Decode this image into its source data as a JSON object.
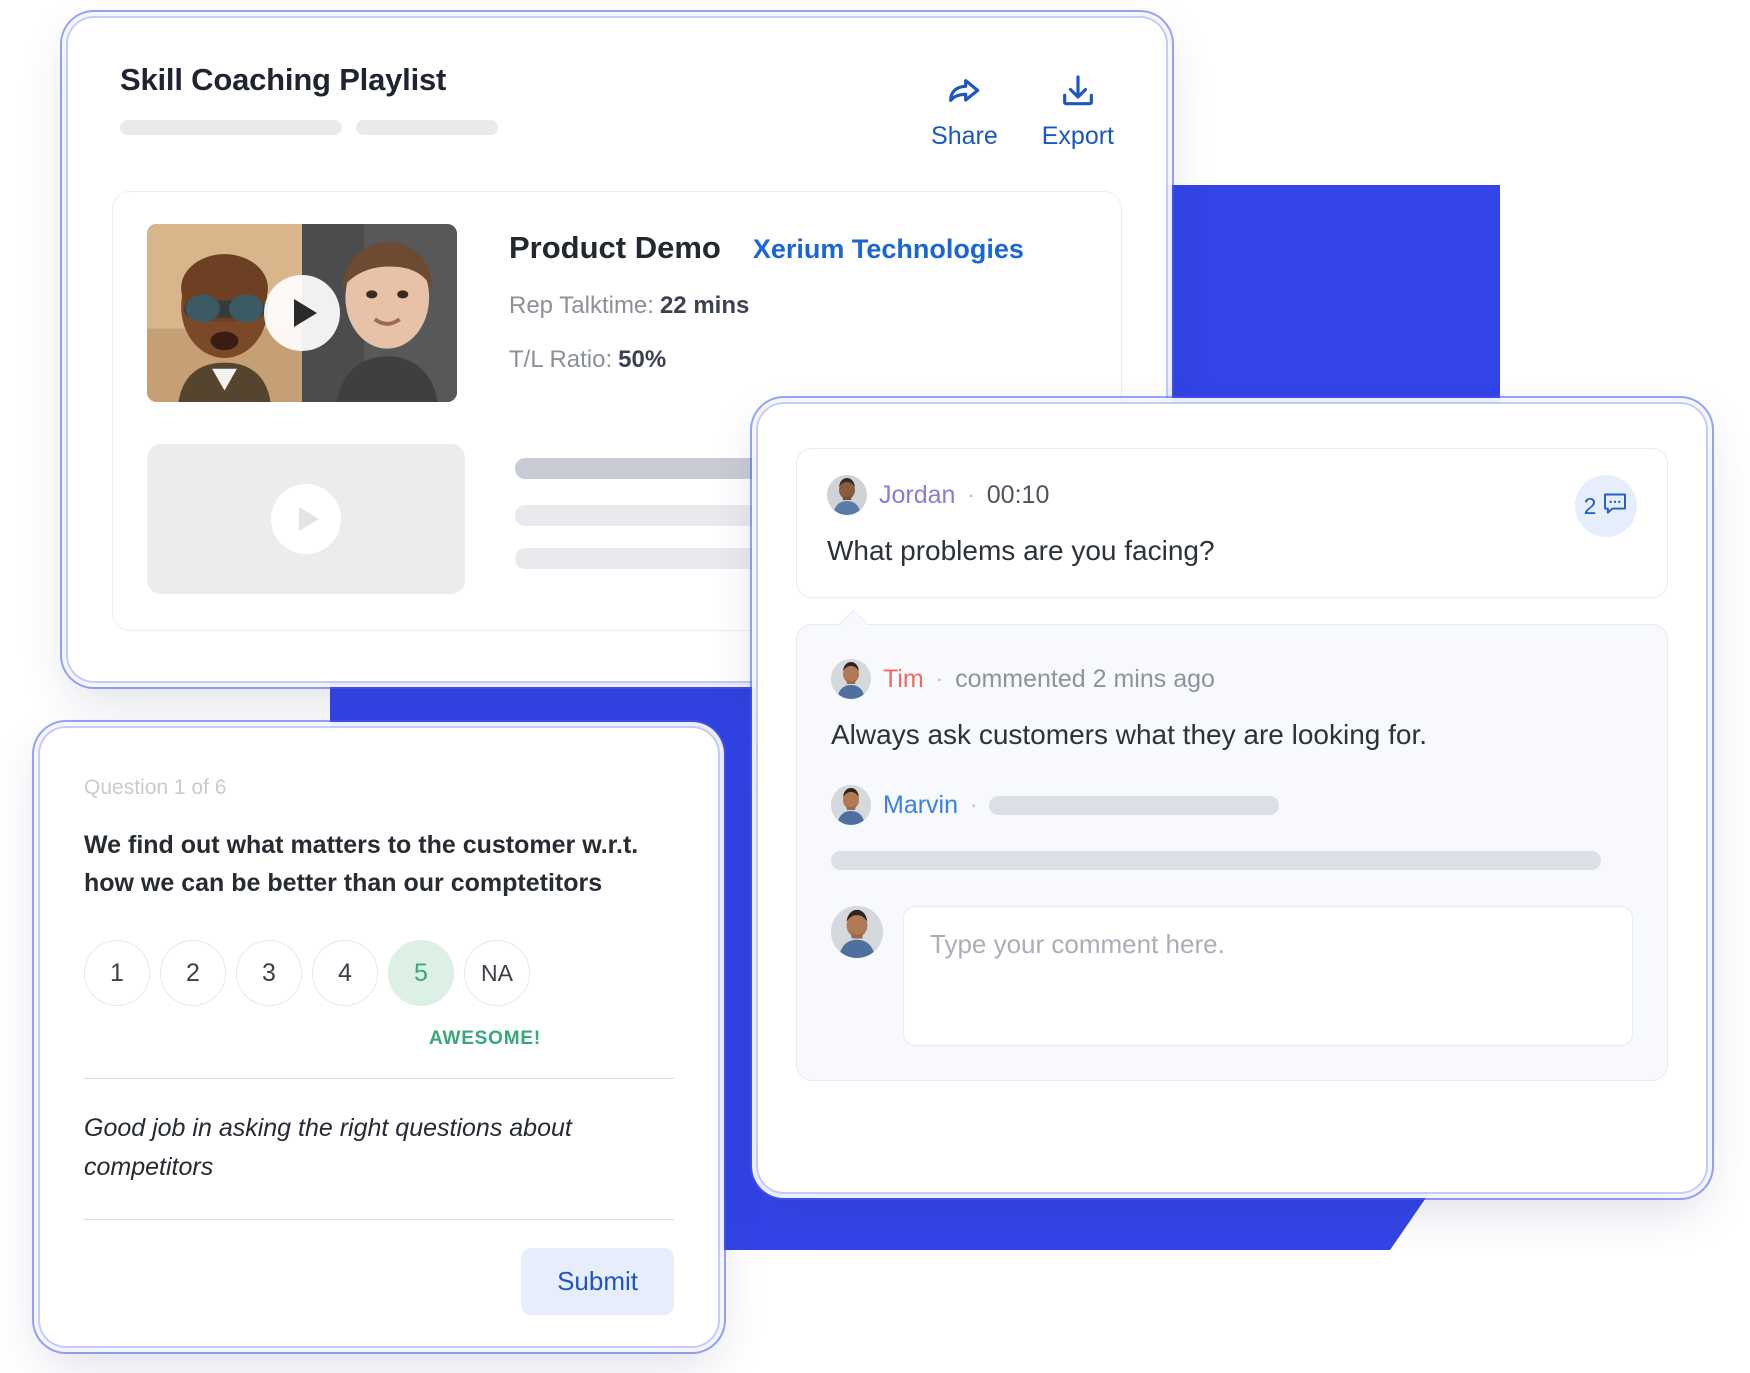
{
  "playlist": {
    "title": "Skill Coaching Playlist",
    "actions": [
      {
        "id": "share",
        "label": "Share",
        "icon": "share-icon"
      },
      {
        "id": "export",
        "label": "Export",
        "icon": "download-icon"
      }
    ],
    "demo": {
      "title": "Product Demo",
      "org": "Xerium Technologies",
      "stats": [
        {
          "label": "Rep Talktime:",
          "value": "22 mins"
        },
        {
          "label": "T/L Ratio:",
          "value": "50%"
        }
      ]
    }
  },
  "comments": {
    "prompt": {
      "author": "Jordan",
      "separator": "·",
      "timestamp": "00:10",
      "text": "What problems are you facing?",
      "badge_count": "2",
      "badge_icon": "comment-icon"
    },
    "thread": [
      {
        "author": "Tim",
        "separator": "·",
        "meta": "commented 2 mins ago",
        "text": "Always ask customers what they are looking for."
      },
      {
        "author": "Marvin",
        "separator": "·",
        "meta": "",
        "text": ""
      }
    ],
    "reply_placeholder": "Type your comment here."
  },
  "question": {
    "counter": "Question 1 of 6",
    "text": "We find out what matters to the customer w.r.t. how we can be better than our comptetitors",
    "scale": [
      {
        "label": "1",
        "selected": false
      },
      {
        "label": "2",
        "selected": false
      },
      {
        "label": "3",
        "selected": false
      },
      {
        "label": "4",
        "selected": false
      },
      {
        "label": "5",
        "selected": true
      },
      {
        "label": "NA",
        "selected": false
      }
    ],
    "rating_caption": "AWESOME!",
    "feedback": "Good job in asking the right questions about competitors",
    "submit_label": "Submit"
  },
  "colors": {
    "brand_blue": "#3344e8",
    "link_blue": "#1a66d6",
    "accent_green": "#3aa77a",
    "accent_green_bg": "#dcf0e6",
    "name_purple": "#8b7bd8",
    "name_red": "#f4675f",
    "name_blue": "#3b82e0"
  }
}
